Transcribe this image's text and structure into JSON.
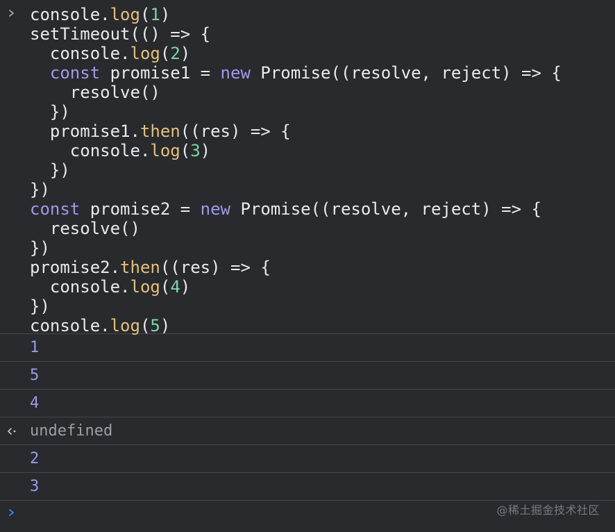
{
  "colors": {
    "background": "#282a2e",
    "divider": "#454850",
    "code_text": "#e8eaed",
    "function_name": "#e5c07b",
    "number": "#7ed6a4",
    "keyword": "#9d9be8",
    "log_number": "#9d9be8",
    "result_text": "#9aa0a6",
    "prompt_chevron_active": "#3b82f6",
    "prompt_chevron_history": "#9aa0a6"
  },
  "icons": {
    "history_prompt": "chevron-right-icon",
    "result_marker": "return-arrow-icon",
    "input_prompt": "chevron-right-icon"
  },
  "code": {
    "l1": [
      "console.",
      "log",
      "(",
      "1",
      ")"
    ],
    "l2": [
      "setTimeout(() => {"
    ],
    "l3": [
      "  console.",
      "log",
      "(",
      "2",
      ")"
    ],
    "l4": [
      "  ",
      "const",
      " promise1 = ",
      "new",
      " Promise((resolve, reject) => {"
    ],
    "l5": [
      "    resolve()"
    ],
    "l6": [
      "  })"
    ],
    "l7": [
      "  promise1.",
      "then",
      "((res) => {"
    ],
    "l8": [
      "    console.",
      "log",
      "(",
      "3",
      ")"
    ],
    "l9": [
      "  })"
    ],
    "l10": [
      "})"
    ],
    "l11": [
      "const",
      " promise2 = ",
      "new",
      " Promise((resolve, reject) => {"
    ],
    "l12": [
      "  resolve()"
    ],
    "l13": [
      "})"
    ],
    "l14": [
      "promise2.",
      "then",
      "((res) => {"
    ],
    "l15": [
      "  console.",
      "log",
      "(",
      "4",
      ")"
    ],
    "l16": [
      "})"
    ],
    "l17": [
      "console.",
      "log",
      "(",
      "5",
      ")"
    ]
  },
  "output": {
    "o1": "1",
    "o2": "5",
    "o3": "4",
    "result": "undefined",
    "o4": "2",
    "o5": "3"
  },
  "watermark": "@稀土掘金技术社区"
}
